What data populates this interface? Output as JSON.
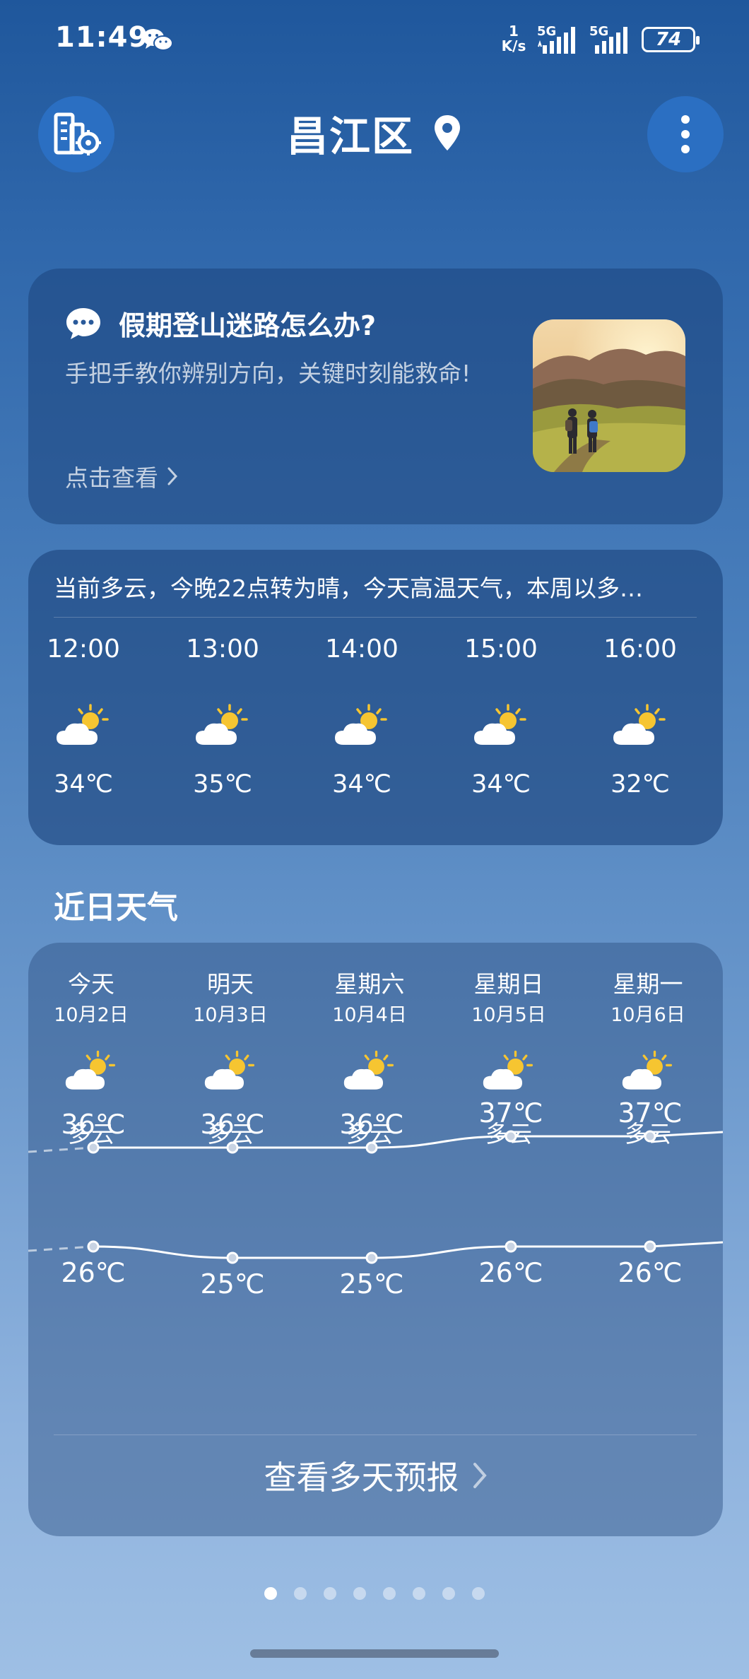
{
  "status_bar": {
    "time": "11:49",
    "net_speed_value": "1",
    "net_speed_unit": "K/s",
    "signal1_label": "5G",
    "signal2_label": "5G",
    "battery": "74"
  },
  "header": {
    "location": "昌江区"
  },
  "news": {
    "title": "假期登山迷路怎么办?",
    "description": "手把手教你辨别方向，关键时刻能救命!",
    "link_label": "点击查看"
  },
  "hourly": {
    "summary": "当前多云，今晚22点转为晴，今天高温天气，本周以多…",
    "items": [
      {
        "time": "12:00",
        "temp": "34℃",
        "icon": "partly-cloudy-icon"
      },
      {
        "time": "13:00",
        "temp": "35℃",
        "icon": "partly-cloudy-icon"
      },
      {
        "time": "14:00",
        "temp": "34℃",
        "icon": "partly-cloudy-icon"
      },
      {
        "time": "15:00",
        "temp": "34℃",
        "icon": "partly-cloudy-icon"
      },
      {
        "time": "16:00",
        "temp": "32℃",
        "icon": "partly-cloudy-icon"
      }
    ]
  },
  "daily": {
    "section_title": "近日天气",
    "days": [
      {
        "name": "今天",
        "date": "10月2日",
        "condition": "多云",
        "high": "36℃",
        "low": "26℃",
        "high_value": 36,
        "low_value": 26
      },
      {
        "name": "明天",
        "date": "10月3日",
        "condition": "多云",
        "high": "36℃",
        "low": "25℃",
        "high_value": 36,
        "low_value": 25
      },
      {
        "name": "星期六",
        "date": "10月4日",
        "condition": "多云",
        "high": "36℃",
        "low": "25℃",
        "high_value": 36,
        "low_value": 25
      },
      {
        "name": "星期日",
        "date": "10月5日",
        "condition": "多云",
        "high": "37℃",
        "low": "26℃",
        "high_value": 37,
        "low_value": 26
      },
      {
        "name": "星期一",
        "date": "10月6日",
        "condition": "多云",
        "high": "37℃",
        "low": "26℃",
        "high_value": 37,
        "low_value": 26
      }
    ],
    "more_label": "查看多天预报"
  },
  "pager": {
    "total": 8,
    "active": 1
  },
  "colors": {
    "sun": "#f6c531",
    "cloud": "#ffffff",
    "button_blue": "#2b6fc2"
  }
}
